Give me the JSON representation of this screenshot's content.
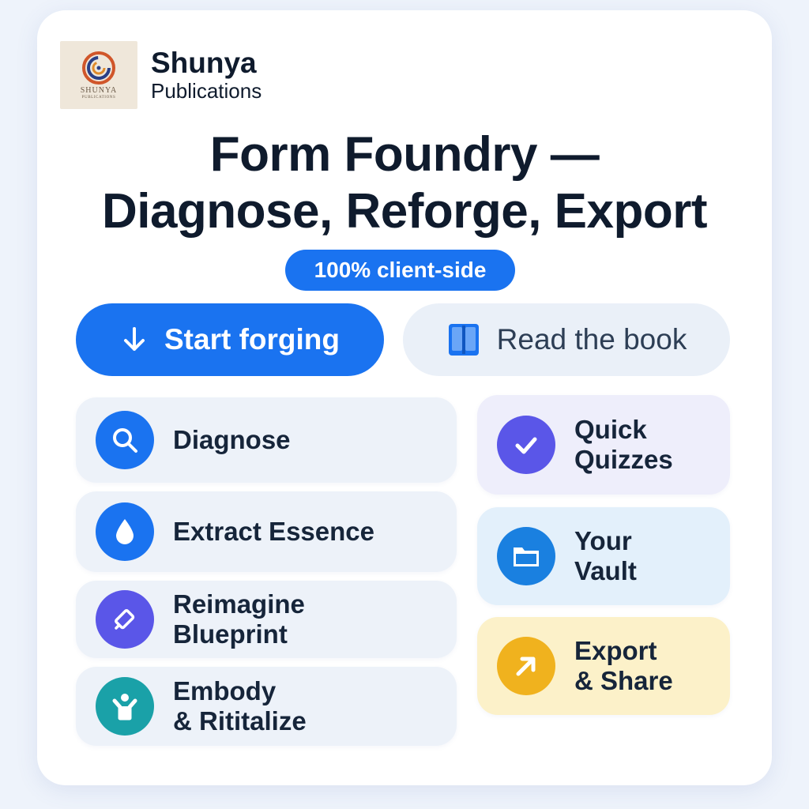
{
  "brand": {
    "name": "Shunya",
    "sub": "Publications",
    "logo_text": "SHUNYA",
    "logo_sub": "PUBLICATIONS"
  },
  "title": {
    "line1": "Form Foundry —",
    "line2": "Diagnose, Reforge, Export"
  },
  "badge": "100% client-side",
  "actions": {
    "primary": {
      "label": "Start forging",
      "icon": "arrow-down-icon"
    },
    "secondary": {
      "label": "Read the book",
      "icon": "book-icon"
    }
  },
  "features_left": [
    {
      "label": "Diagnose",
      "icon": "search-icon",
      "color": "#1a73f0"
    },
    {
      "label": "Extract Essence",
      "icon": "drop-icon",
      "color": "#1a73f0"
    },
    {
      "label": "Reimagine\nBlueprint",
      "icon": "pen-icon",
      "color": "#5a56e8"
    },
    {
      "label": "Embody\n& Rititalize",
      "icon": "person-icon",
      "color": "#1aa1a8"
    }
  ],
  "features_right": [
    {
      "label": "Quick\nQuizzes",
      "icon": "check-icon",
      "color": "#5a56e8",
      "bg": "#eeeefb"
    },
    {
      "label": "Your\nVault",
      "icon": "folder-icon",
      "color": "#1a80e0",
      "bg": "#e3f0fb"
    },
    {
      "label": "Export\n& Share",
      "icon": "arrow-up-right-icon",
      "color": "#f0b21e",
      "bg": "#fcf1c9"
    }
  ]
}
